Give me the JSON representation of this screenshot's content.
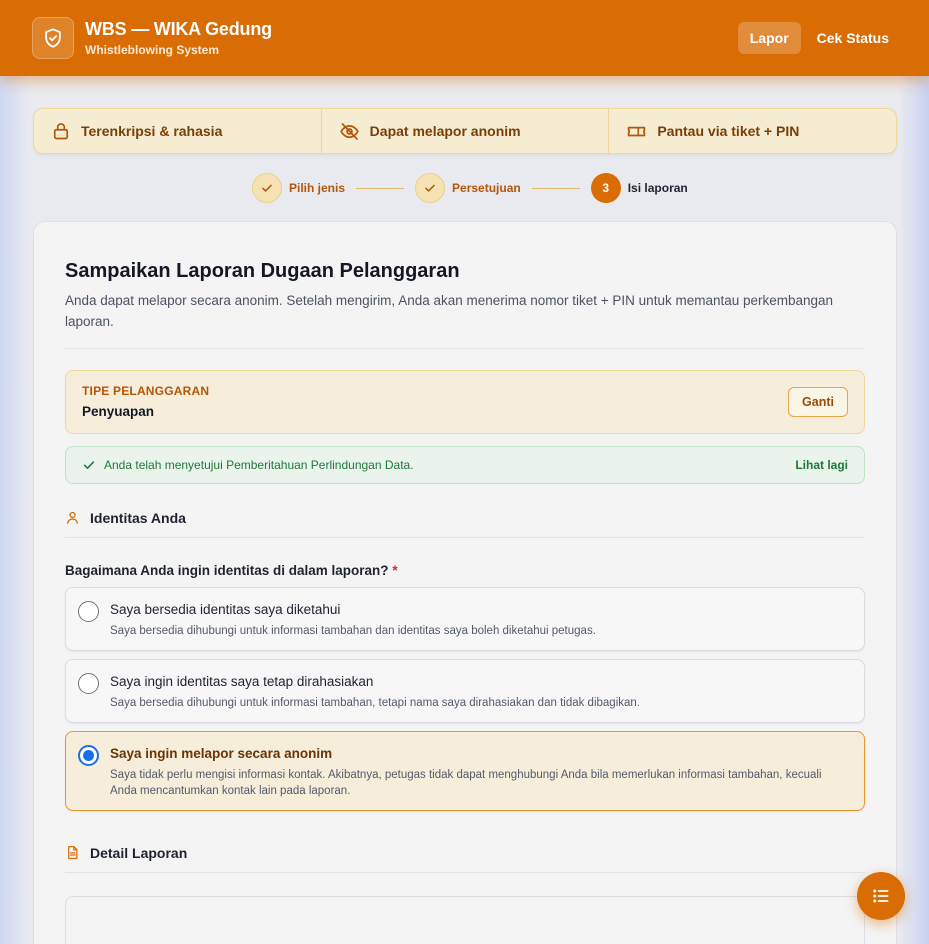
{
  "header": {
    "title": "WBS — WIKA Gedung",
    "subtitle": "Whistleblowing System",
    "nav": {
      "lapor": "Lapor",
      "cek_status": "Cek Status"
    }
  },
  "features": [
    {
      "label": "Terenkripsi & rahasia",
      "icon": "lock-icon"
    },
    {
      "label": "Dapat melapor anonim",
      "icon": "eye-off-icon"
    },
    {
      "label": "Pantau via tiket + PIN",
      "icon": "ticket-icon"
    }
  ],
  "stepper": {
    "steps": [
      {
        "label": "Pilih jenis",
        "state": "done"
      },
      {
        "label": "Persetujuan",
        "state": "done"
      },
      {
        "number": "3",
        "label": "Isi laporan",
        "state": "current"
      }
    ]
  },
  "form": {
    "title": "Sampaikan Laporan Dugaan Pelanggaran",
    "description": "Anda dapat melapor secara anonim. Setelah mengirim, Anda akan menerima nomor tiket + PIN untuk memantau perkembangan laporan.",
    "violation_type": {
      "label": "TIPE PELANGGARAN",
      "value": "Penyuapan",
      "change_label": "Ganti"
    },
    "consent": {
      "text": "Anda telah menyetujui Pemberitahuan Perlindungan Data.",
      "link": "Lihat lagi"
    },
    "identity_section": "Identitas Anda",
    "identity_question": "Bagaimana Anda ingin identitas di dalam laporan?",
    "required_mark": "*",
    "options": [
      {
        "title": "Saya bersedia identitas saya diketahui",
        "desc": "Saya bersedia dihubungi untuk informasi tambahan dan identitas saya boleh diketahui petugas.",
        "selected": false
      },
      {
        "title": "Saya ingin identitas saya tetap dirahasiakan",
        "desc": "Saya bersedia dihubungi untuk informasi tambahan, tetapi nama saya dirahasiakan dan tidak dibagikan.",
        "selected": false
      },
      {
        "title": "Saya ingin melapor secara anonim",
        "desc": "Saya tidak perlu mengisi informasi kontak. Akibatnya, petugas tidak dapat menghubungi Anda bila memerlukan informasi tambahan, kecuali Anda mencantumkan kontak lain pada laporan.",
        "selected": true
      }
    ],
    "detail_section": "Detail Laporan"
  },
  "colors": {
    "brand": "#d96c03",
    "accent_text": "#b3560a",
    "success": "#1f7a3a",
    "radio_selected": "#1a6fe8",
    "required": "#d2292d"
  }
}
